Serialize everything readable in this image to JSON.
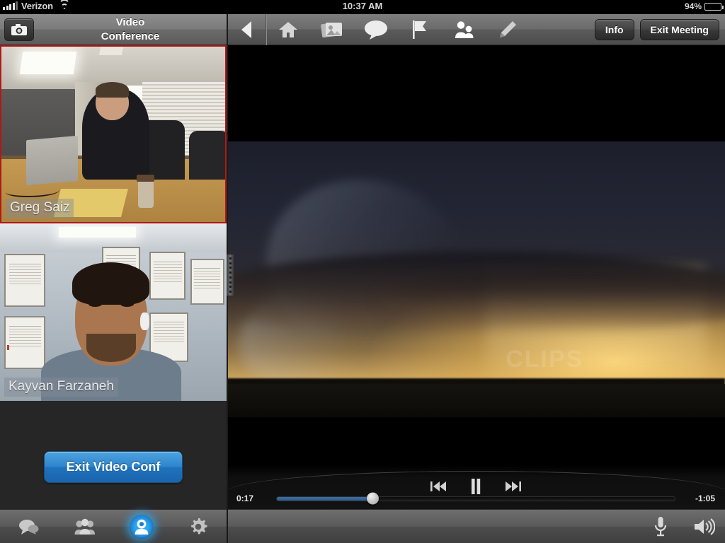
{
  "status_bar": {
    "carrier": "Verizon",
    "time": "10:37 AM",
    "battery_percent": "94%",
    "signal_icon": "signal-bars-icon",
    "wifi_icon": "wifi-icon",
    "battery_icon": "battery-icon"
  },
  "sidebar": {
    "title_line1": "Video",
    "title_line2": "Conference",
    "camera_button_icon": "camera-icon",
    "participants": [
      {
        "name": "Greg Saiz",
        "active_speaker": true
      },
      {
        "name": "Kayvan Farzaneh",
        "active_speaker": false
      }
    ],
    "exit_video_conf_label": "Exit Video Conf",
    "tabs": [
      {
        "name": "chat",
        "icon": "chat-bubbles-icon",
        "active": false
      },
      {
        "name": "participants",
        "icon": "people-group-icon",
        "active": false
      },
      {
        "name": "video",
        "icon": "webcam-icon",
        "active": true
      },
      {
        "name": "settings",
        "icon": "gear-icon",
        "active": false
      }
    ],
    "active_border_color": "#b11818"
  },
  "toolbar": {
    "back_icon": "back-arrow-icon",
    "items": [
      {
        "name": "home",
        "icon": "home-icon"
      },
      {
        "name": "photos",
        "icon": "photos-icon"
      },
      {
        "name": "chat",
        "icon": "chat-bubble-icon"
      },
      {
        "name": "flag",
        "icon": "flag-icon"
      },
      {
        "name": "participants",
        "icon": "people-icon"
      },
      {
        "name": "annotate",
        "icon": "pen-icon"
      }
    ],
    "info_label": "Info",
    "exit_meeting_label": "Exit Meeting"
  },
  "player": {
    "current_time": "0:17",
    "remaining_time": "-1:05",
    "progress_percent": 24,
    "state": "playing",
    "rewind_icon": "rewind-icon",
    "pause_icon": "pause-icon",
    "forward_icon": "fast-forward-icon",
    "scrubber_fill_color": "#3c6fa8",
    "watermark": "CLIPS"
  },
  "bottom_bar": {
    "microphone_icon": "microphone-icon",
    "speaker_icon": "speaker-icon"
  },
  "splitter": {
    "icon": "drag-handle-icon"
  }
}
